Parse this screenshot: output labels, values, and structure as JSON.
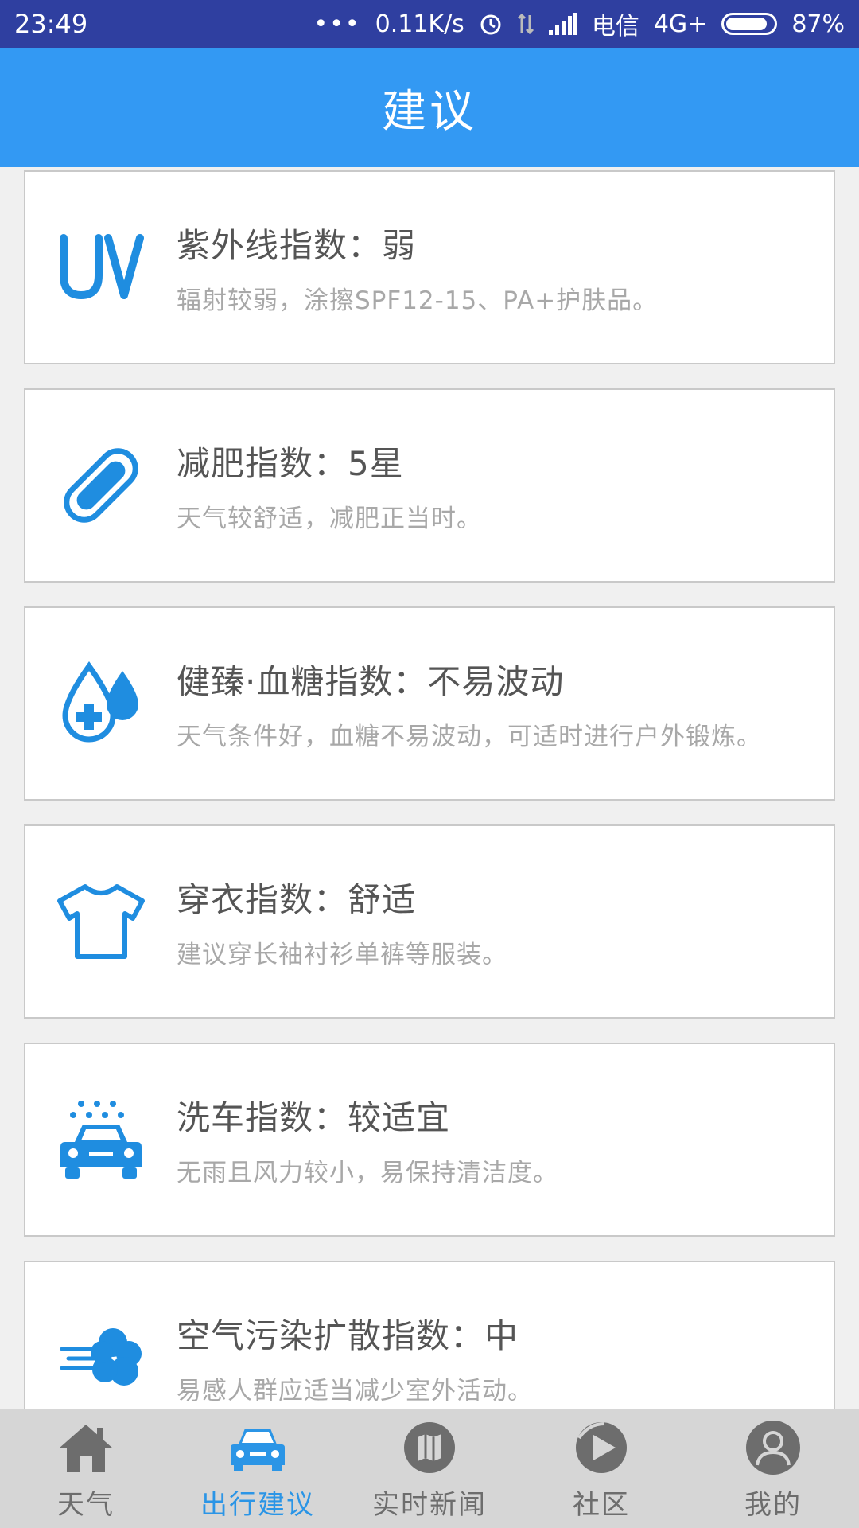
{
  "status_bar": {
    "time": "23:49",
    "speed": "0.11K/s",
    "carrier": "电信",
    "network": "4G+",
    "battery": "87%"
  },
  "header": {
    "title": "建议"
  },
  "cards": [
    {
      "icon": "uv-icon",
      "title": "紫外线指数：弱",
      "desc": "辐射较弱，涂擦SPF12-15、PA+护肤品。"
    },
    {
      "icon": "bandage-icon",
      "title": "减肥指数：5星",
      "desc": "天气较舒适，减肥正当时。"
    },
    {
      "icon": "blood-drop-icon",
      "title": "健臻·血糖指数：不易波动",
      "desc": "天气条件好，血糖不易波动，可适时进行户外锻炼。"
    },
    {
      "icon": "tshirt-icon",
      "title": "穿衣指数：舒适",
      "desc": "建议穿长袖衬衫单裤等服装。"
    },
    {
      "icon": "car-wash-icon",
      "title": "洗车指数：较适宜",
      "desc": "无雨且风力较小，易保持清洁度。"
    },
    {
      "icon": "air-pollution-icon",
      "title": "空气污染扩散指数：中",
      "desc": "易感人群应适当减少室外活动。"
    }
  ],
  "nav": [
    {
      "label": "天气",
      "icon": "house-icon",
      "active": false
    },
    {
      "label": "出行建议",
      "icon": "car-icon",
      "active": true
    },
    {
      "label": "实时新闻",
      "icon": "map-icon",
      "active": false
    },
    {
      "label": "社区",
      "icon": "play-circle-icon",
      "active": false
    },
    {
      "label": "我的",
      "icon": "user-icon",
      "active": false
    }
  ],
  "colors": {
    "accent": "#3399f3",
    "icon_blue": "#1f8de0",
    "status_bar": "#2f3fa0"
  }
}
